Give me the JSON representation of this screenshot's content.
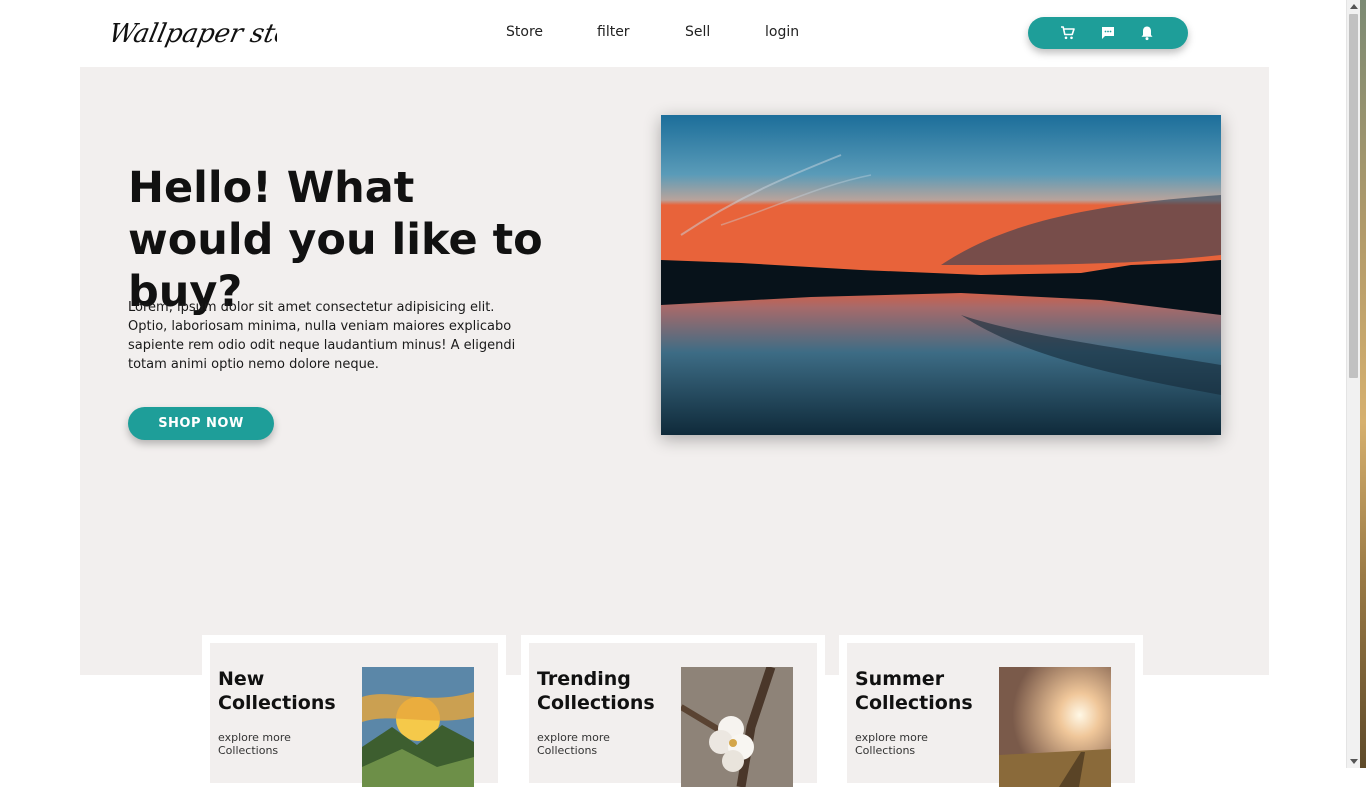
{
  "header": {
    "logo_text": "Wallpaper store",
    "nav": [
      "Store",
      "filter",
      "Sell",
      "login"
    ],
    "icons": [
      "cart-icon",
      "message-icon",
      "bell-icon"
    ]
  },
  "hero": {
    "title": "Hello! What would you like to buy?",
    "text": "Lorem, ipsum dolor sit amet consectetur adipisicing elit. Optio, laboriosam minima, nulla veniam maiores explicabo sapiente rem odio odit neque laudantium minus! A eligendi totam animi optio nemo dolore neque.",
    "cta": "SHOP NOW"
  },
  "collections": [
    {
      "title": "New Collections",
      "link": "explore more Collections"
    },
    {
      "title": "Trending Collections",
      "link": "explore more Collections"
    },
    {
      "title": "Summer Collections",
      "link": "explore more Collections"
    }
  ],
  "colors": {
    "accent": "#1e9e99",
    "hero_bg": "#f2efee",
    "text": "#111111"
  }
}
